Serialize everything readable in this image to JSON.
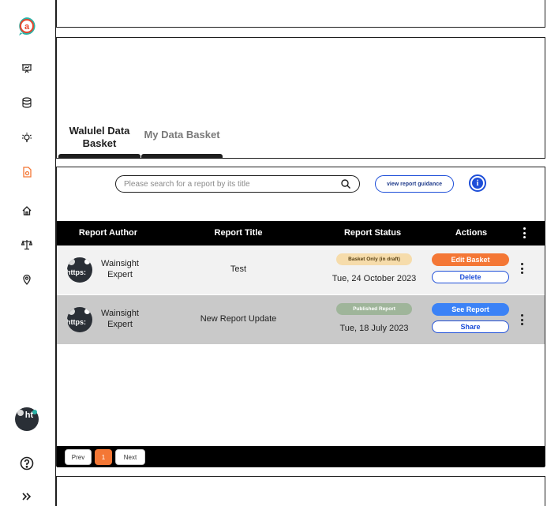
{
  "sidebar": {
    "logo_letter": "a",
    "user_avatar_alt": "ht"
  },
  "tabs": {
    "active_label": "Walulel Data Basket",
    "inactive_label": "My Data Basket"
  },
  "search": {
    "placeholder": "Please search for a report by its title"
  },
  "toolbar": {
    "guidance_label": "view report guidance",
    "info_label": "i"
  },
  "table": {
    "headers": [
      "Report Author",
      "Report Title",
      "Report Status",
      "Actions"
    ],
    "rows": [
      {
        "avatar_alt": "https:",
        "author": "Wainsight Expert",
        "title": "Test",
        "status": "Basket Only (in draft)",
        "date": "Tue, 24 October 2023",
        "primary_action": "Edit Basket",
        "secondary_action": "Delete"
      },
      {
        "avatar_alt": "https:",
        "author": "Wainsight Expert",
        "title": "New Report Update",
        "status": "Published Report",
        "date": "Tue, 18 July 2023",
        "primary_action": "See Report",
        "secondary_action": "Share"
      }
    ]
  },
  "pagination": {
    "prev": "Prev",
    "current": "1",
    "next": "Next"
  },
  "colors": {
    "accent_orange": "#f47735",
    "accent_blue": "#3b82f6",
    "brand_teal": "#2bb3a7",
    "brand_red": "#e8452c"
  }
}
